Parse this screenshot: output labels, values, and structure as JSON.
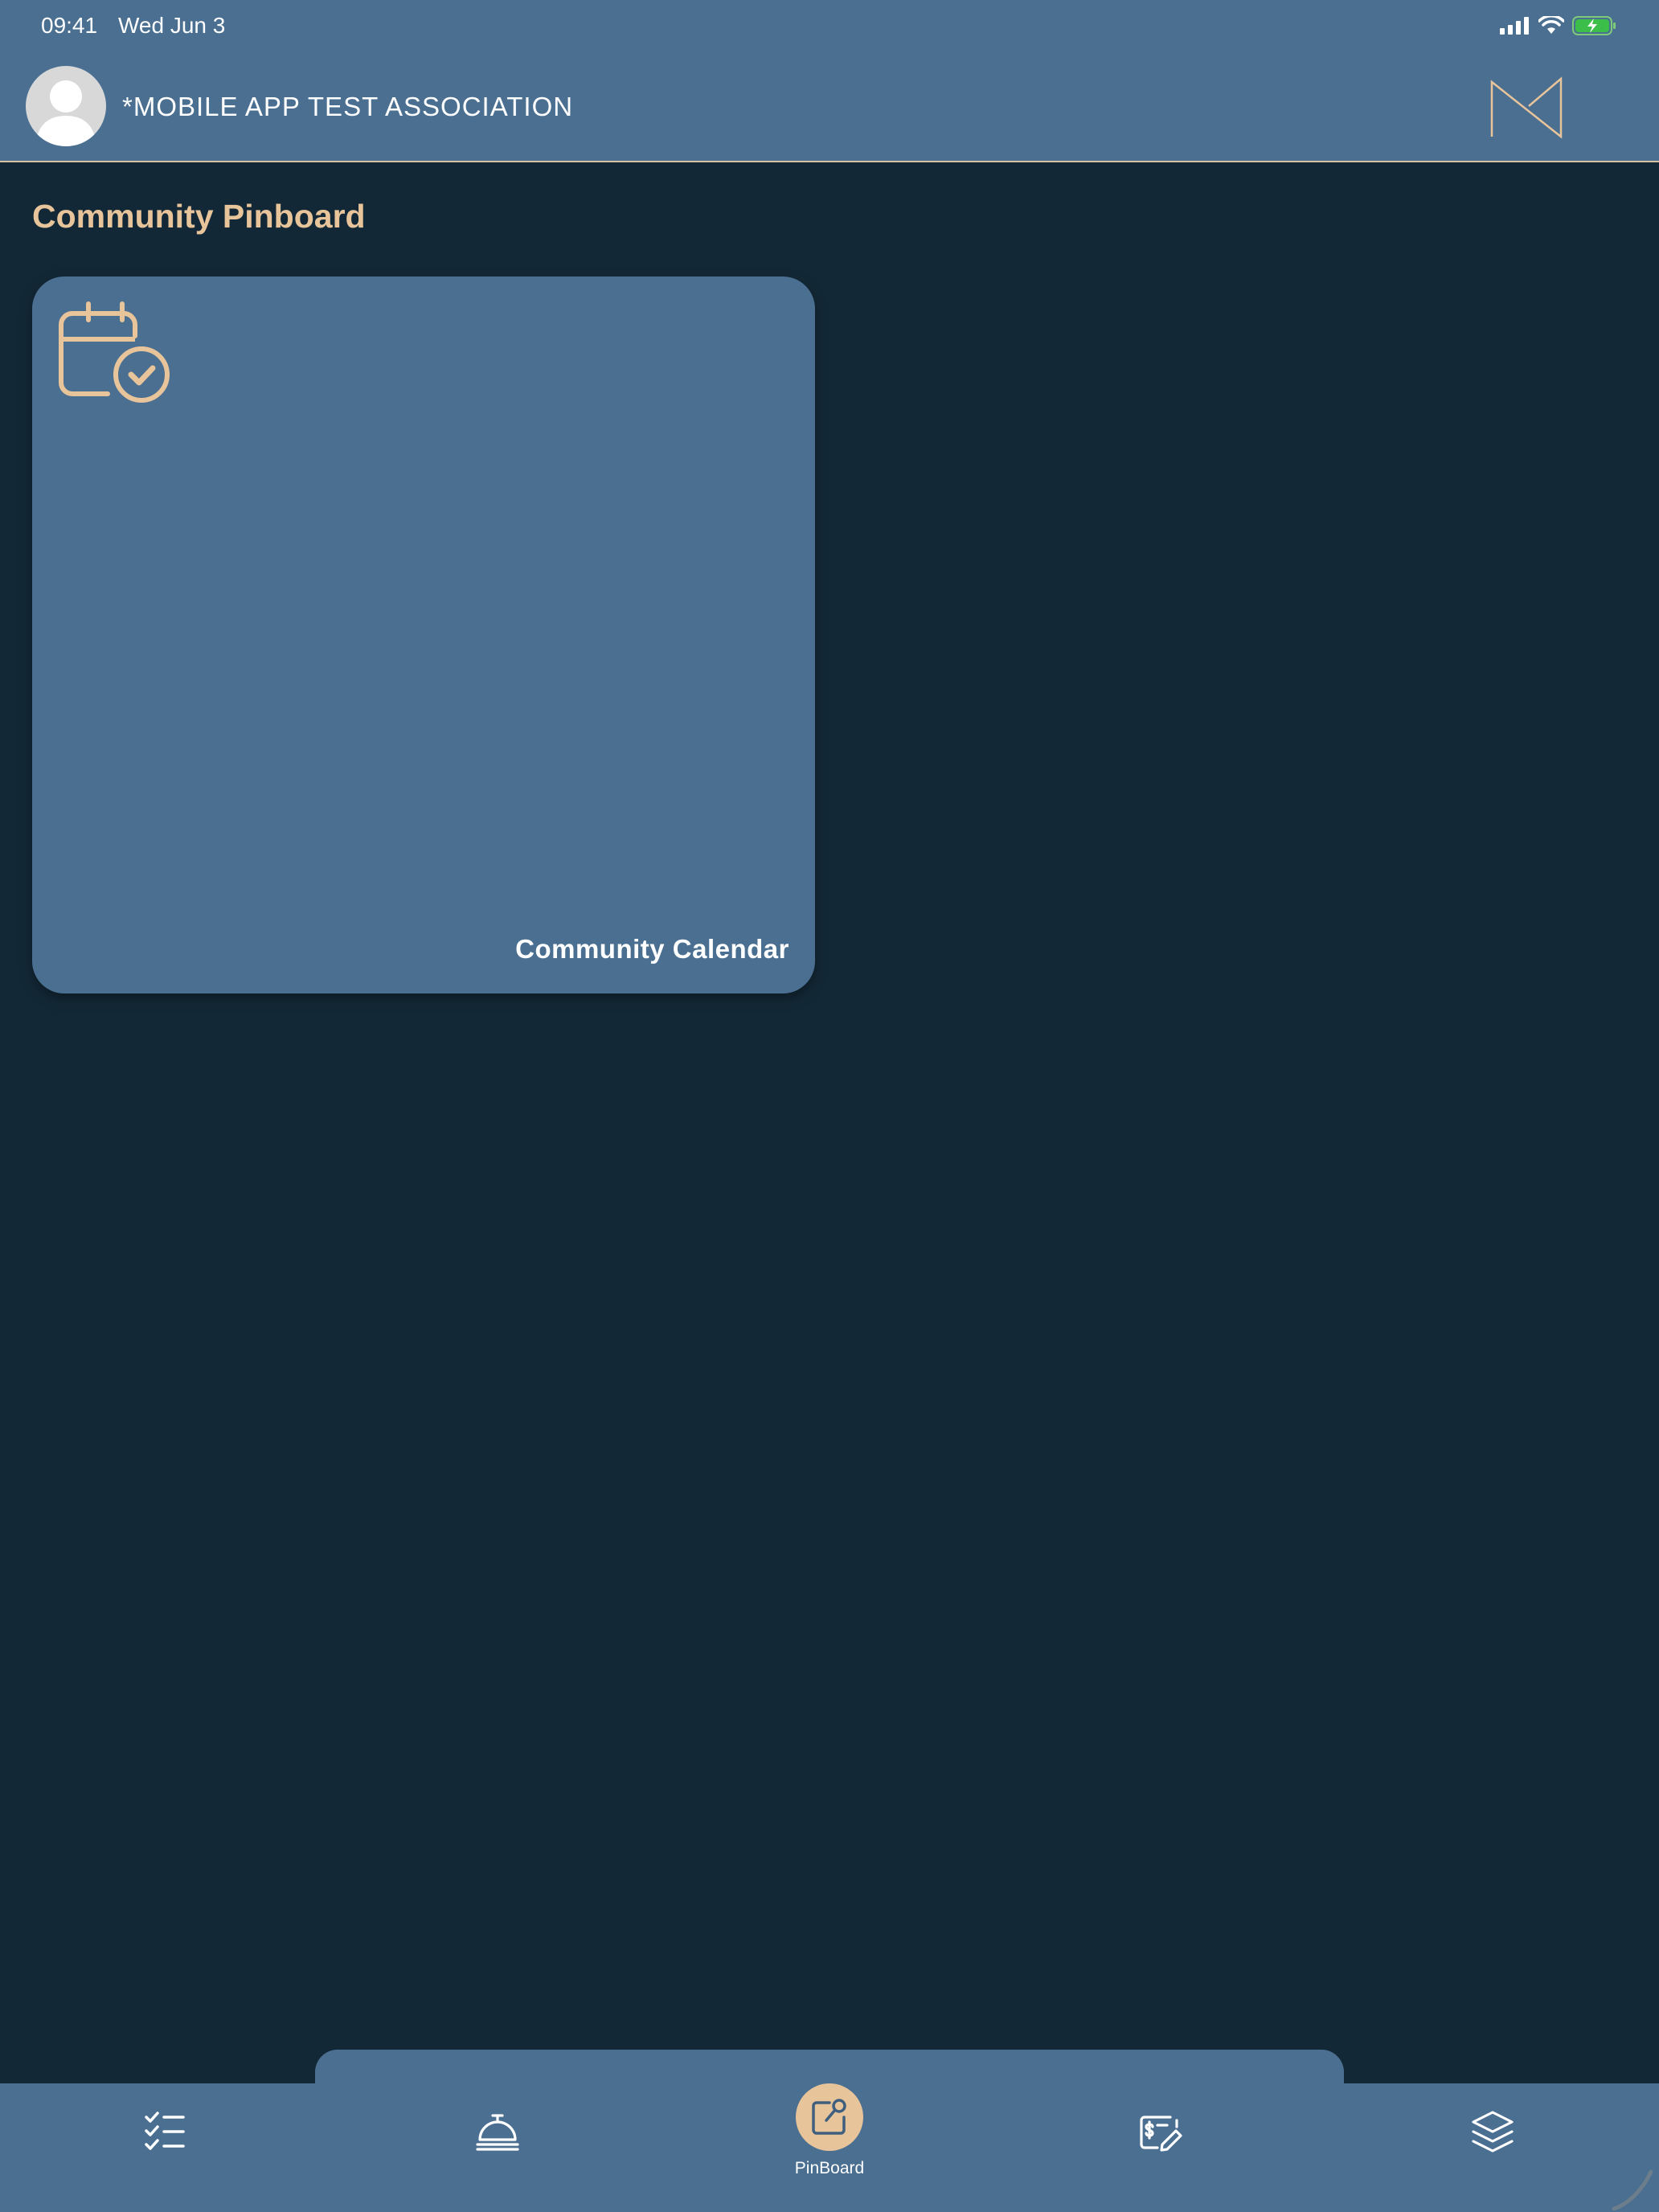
{
  "status_bar": {
    "time": "09:41",
    "date": "Wed Jun 3"
  },
  "header": {
    "association_name": "*MOBILE APP TEST ASSOCIATION",
    "avatar_icon": "default-user-avatar",
    "logo_icon": "m-logo"
  },
  "page": {
    "title": "Community Pinboard"
  },
  "cards": [
    {
      "label": "Community Calendar",
      "icon": "calendar-check-icon"
    }
  ],
  "tab_bar": {
    "items": [
      {
        "icon": "checklist-icon",
        "label": ""
      },
      {
        "icon": "service-bell-icon",
        "label": ""
      },
      {
        "icon": "pinboard-icon",
        "label": "PinBoard",
        "active": true
      },
      {
        "icon": "payment-icon",
        "label": ""
      },
      {
        "icon": "layers-icon",
        "label": ""
      }
    ]
  },
  "colors": {
    "background": "#132836",
    "header": "#4a6f91",
    "accent": "#e8c49b"
  }
}
